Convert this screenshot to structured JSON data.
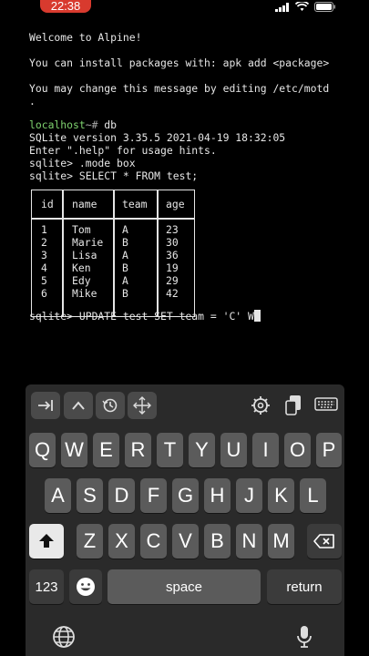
{
  "status": {
    "time": "22:38"
  },
  "terminal": {
    "motd_1": "Welcome to Alpine!",
    "motd_2": "You can install packages with: apk add <package>",
    "motd_3": "You may change this message by editing /etc/motd",
    "motd_4": ".",
    "prompt_host": "localhost",
    "prompt_tilde": "~#",
    "cmd_db": " db",
    "sqlite_version": "SQLite version 3.35.5 2021-04-19 18:32:05",
    "hint": "Enter \".help\" for usage hints.",
    "cmd_mode": "sqlite> .mode box",
    "cmd_select": "sqlite> SELECT * FROM test;",
    "cmd_update": "sqlite> UPDATE test SET team = 'C' W"
  },
  "table": {
    "headers": [
      "id",
      "name",
      "team",
      "age"
    ],
    "rows": [
      [
        "1",
        "Tom",
        "A",
        "23"
      ],
      [
        "2",
        "Marie",
        "B",
        "30"
      ],
      [
        "3",
        "Lisa",
        "A",
        "36"
      ],
      [
        "4",
        "Ken",
        "B",
        "19"
      ],
      [
        "5",
        "Edy",
        "A",
        "29"
      ],
      [
        "6",
        "Mike",
        "B",
        "42"
      ]
    ]
  },
  "keyboard": {
    "row1": [
      "Q",
      "W",
      "E",
      "R",
      "T",
      "Y",
      "U",
      "I",
      "O",
      "P"
    ],
    "row2": [
      "A",
      "S",
      "D",
      "F",
      "G",
      "H",
      "J",
      "K",
      "L"
    ],
    "row3": [
      "Z",
      "X",
      "C",
      "V",
      "B",
      "N",
      "M"
    ],
    "numbers_label": "123",
    "space_label": "space",
    "return_label": "return"
  },
  "toolbar_icons": [
    "tab-icon",
    "up-arrow-icon",
    "history-icon",
    "move-icon",
    "settings-icon",
    "clipboard-icon",
    "keyboard-icon"
  ]
}
